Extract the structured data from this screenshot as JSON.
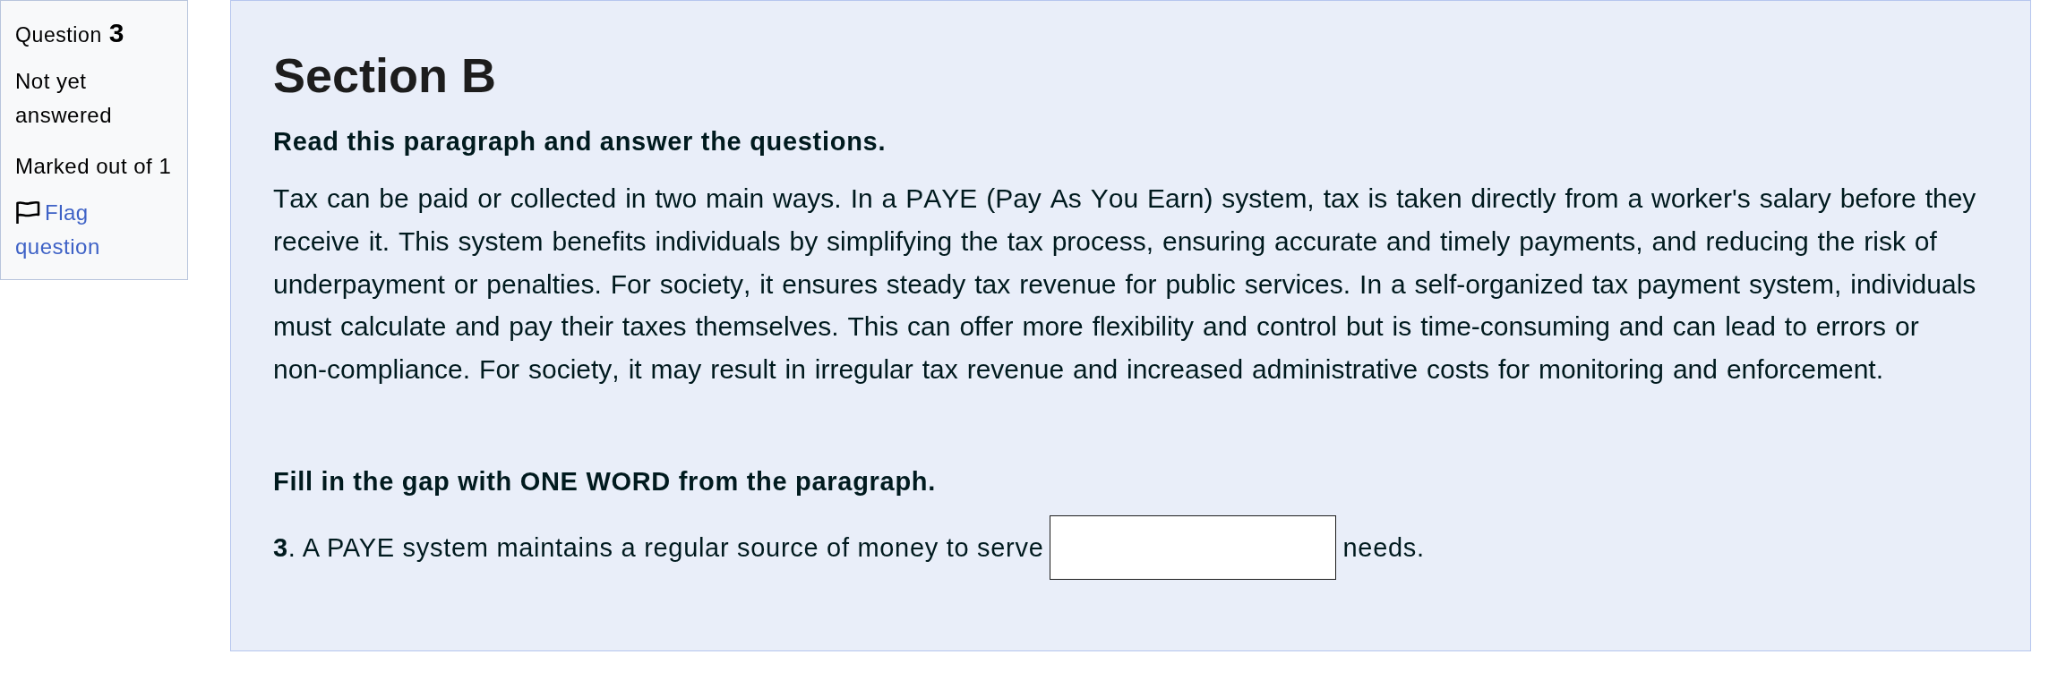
{
  "question_info": {
    "label": "Question",
    "number": "3",
    "state": "Not yet answered",
    "grade": "Marked out of 1",
    "flag": {
      "label": "Flag question",
      "flagged": false
    }
  },
  "content": {
    "heading": "Section B",
    "instruction": "Read this paragraph and answer the questions.",
    "paragraph": "Tax can be paid or collected in two main ways. In a PAYE (Pay As You Earn) system, tax is taken directly from a worker's salary before they receive it. This system benefits individuals by simplifying the tax process, ensuring accurate and timely payments, and reducing the risk of underpayment or penalties. For society, it ensures steady tax revenue for public services. In a self-organized tax payment system, individuals must calculate and pay their taxes themselves. This can offer more flexibility and control but is time-consuming and can lead to errors or non-compliance. For society, it may result in irregular tax revenue and increased administrative costs for monitoring and enforcement.",
    "task": "Fill in the gap with ONE WORD from the paragraph.",
    "question": [
      {
        "kind": "text",
        "text": "**3**. A PAYE system maintains a regular source of money to serve"
      },
      {
        "kind": "blank"
      },
      {
        "kind": "text",
        "text": "needs."
      }
    ]
  }
}
